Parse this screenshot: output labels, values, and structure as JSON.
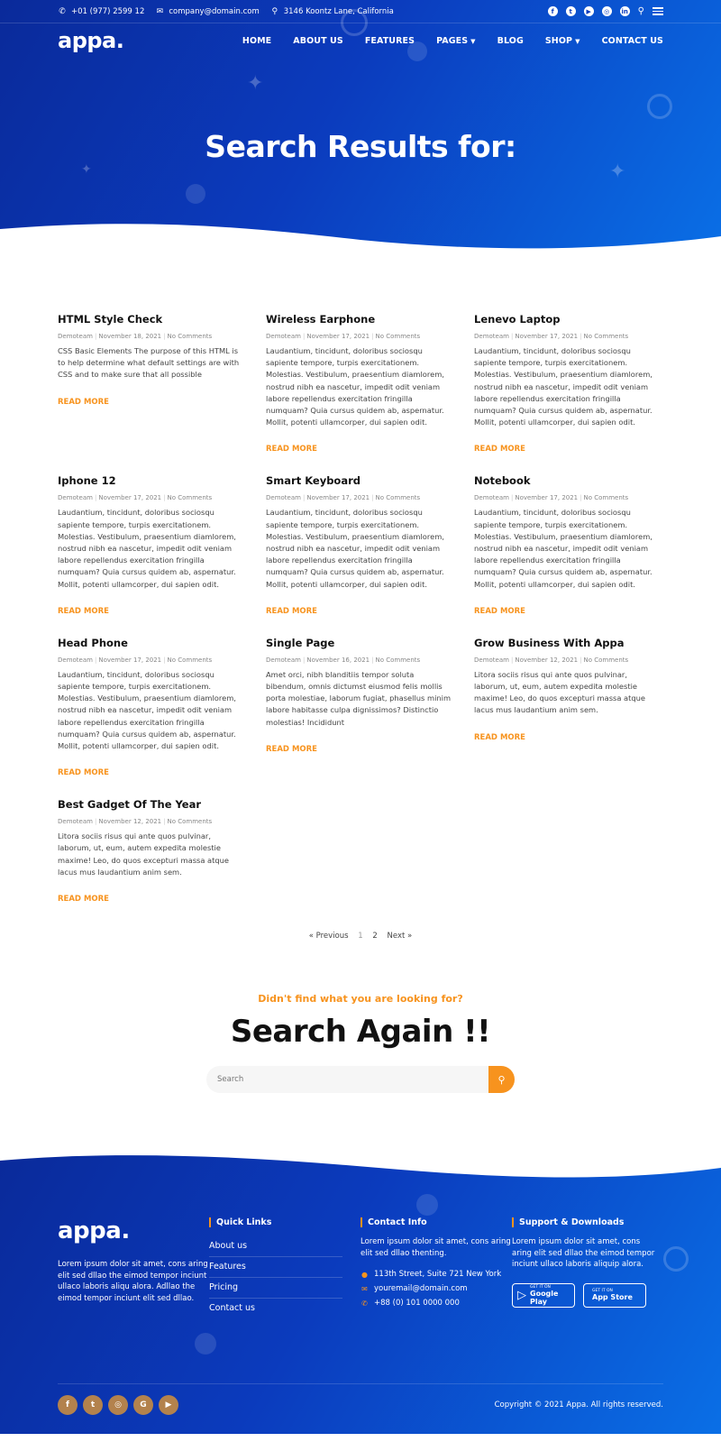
{
  "topbar": {
    "phone": "+01 (977) 2599 12",
    "email": "company@domain.com",
    "address": "3146 Koontz Lane, California"
  },
  "nav": {
    "logo": "appa.",
    "items": [
      {
        "label": "HOME"
      },
      {
        "label": "ABOUT US"
      },
      {
        "label": "FEATURES"
      },
      {
        "label": "PAGES"
      },
      {
        "label": "BLOG"
      },
      {
        "label": "SHOP"
      },
      {
        "label": "CONTACT US"
      }
    ]
  },
  "hero": {
    "title": "Search Results for:"
  },
  "posts": [
    {
      "title": "HTML Style Check",
      "author": "Demoteam",
      "date": "November 18, 2021",
      "comments": "No Comments",
      "excerpt": "CSS Basic Elements The purpose of this HTML is to help determine what default settings are with CSS and to make sure that all possible",
      "more": "READ MORE"
    },
    {
      "title": "Wireless Earphone",
      "author": "Demoteam",
      "date": "November 17, 2021",
      "comments": "No Comments",
      "excerpt": "Laudantium, tincidunt, doloribus sociosqu sapiente tempore, turpis exercitationem. Molestias. Vestibulum, praesentium diamlorem, nostrud nibh ea nascetur, impedit odit veniam labore repellendus exercitation fringilla numquam? Quia cursus quidem ab, aspernatur. Mollit, potenti ullamcorper, dui sapien odit.",
      "more": "READ MORE"
    },
    {
      "title": "Lenevo Laptop",
      "author": "Demoteam",
      "date": "November 17, 2021",
      "comments": "No Comments",
      "excerpt": "Laudantium, tincidunt, doloribus sociosqu sapiente tempore, turpis exercitationem. Molestias. Vestibulum, praesentium diamlorem, nostrud nibh ea nascetur, impedit odit veniam labore repellendus exercitation fringilla numquam? Quia cursus quidem ab, aspernatur. Mollit, potenti ullamcorper, dui sapien odit.",
      "more": "READ MORE"
    },
    {
      "title": "Iphone 12",
      "author": "Demoteam",
      "date": "November 17, 2021",
      "comments": "No Comments",
      "excerpt": "Laudantium, tincidunt, doloribus sociosqu sapiente tempore, turpis exercitationem. Molestias. Vestibulum, praesentium diamlorem, nostrud nibh ea nascetur, impedit odit veniam labore repellendus exercitation fringilla numquam? Quia cursus quidem ab, aspernatur. Mollit, potenti ullamcorper, dui sapien odit.",
      "more": "READ MORE"
    },
    {
      "title": "Smart Keyboard",
      "author": "Demoteam",
      "date": "November 17, 2021",
      "comments": "No Comments",
      "excerpt": "Laudantium, tincidunt, doloribus sociosqu sapiente tempore, turpis exercitationem. Molestias. Vestibulum, praesentium diamlorem, nostrud nibh ea nascetur, impedit odit veniam labore repellendus exercitation fringilla numquam? Quia cursus quidem ab, aspernatur. Mollit, potenti ullamcorper, dui sapien odit.",
      "more": "READ MORE"
    },
    {
      "title": "Notebook",
      "author": "Demoteam",
      "date": "November 17, 2021",
      "comments": "No Comments",
      "excerpt": "Laudantium, tincidunt, doloribus sociosqu sapiente tempore, turpis exercitationem. Molestias. Vestibulum, praesentium diamlorem, nostrud nibh ea nascetur, impedit odit veniam labore repellendus exercitation fringilla numquam? Quia cursus quidem ab, aspernatur. Mollit, potenti ullamcorper, dui sapien odit.",
      "more": "READ MORE"
    },
    {
      "title": "Head Phone",
      "author": "Demoteam",
      "date": "November 17, 2021",
      "comments": "No Comments",
      "excerpt": "Laudantium, tincidunt, doloribus sociosqu sapiente tempore, turpis exercitationem. Molestias. Vestibulum, praesentium diamlorem, nostrud nibh ea nascetur, impedit odit veniam labore repellendus exercitation fringilla numquam? Quia cursus quidem ab, aspernatur. Mollit, potenti ullamcorper, dui sapien odit.",
      "more": "READ MORE"
    },
    {
      "title": "Single Page",
      "author": "Demoteam",
      "date": "November 16, 2021",
      "comments": "No Comments",
      "excerpt": "Amet orci, nibh blanditiis tempor soluta bibendum, omnis dictumst eiusmod felis mollis porta molestiae, laborum fugiat, phasellus minim labore habitasse culpa dignissimos? Distinctio molestias! Incididunt",
      "more": "READ MORE"
    },
    {
      "title": "Grow Business With Appa",
      "author": "Demoteam",
      "date": "November 12, 2021",
      "comments": "No Comments",
      "excerpt": "Litora sociis risus qui ante quos pulvinar, laborum, ut, eum, autem expedita molestie maxime! Leo, do quos excepturi massa atque lacus mus laudantium anim sem.",
      "more": "READ MORE"
    },
    {
      "title": "Best Gadget Of The Year",
      "author": "Demoteam",
      "date": "November 12, 2021",
      "comments": "No Comments",
      "excerpt": "Litora sociis risus qui ante quos pulvinar, laborum, ut, eum, autem expedita molestie maxime! Leo, do quos excepturi massa atque lacus mus laudantium anim sem.",
      "more": "READ MORE"
    }
  ],
  "pagination": {
    "prev": "« Previous",
    "page1": "1",
    "page2": "2",
    "next": "Next »"
  },
  "search_again": {
    "subtitle": "Didn't find what you are looking for?",
    "title": "Search Again !!",
    "placeholder": "Search"
  },
  "footer": {
    "logo": "appa.",
    "about": "Lorem ipsum dolor sit amet, cons aring elit sed dllao the eimod tempor inciunt ullaco laboris aliqu alora. Adllao the eimod tempor inciunt elit sed dllao.",
    "quick_links_title": "Quick Links",
    "quick_links": [
      "About us",
      "Features",
      "Pricing",
      "Contact us"
    ],
    "contact_title": "Contact Info",
    "contact_text": "Lorem ipsum dolor sit amet, cons aring elit sed dllao thenting.",
    "contact_address": "113th Street, Suite 721 New York",
    "contact_email": "youremail@domain.com",
    "contact_phone": "+88 (0) 101 0000 000",
    "support_title": "Support & Downloads",
    "support_text": "Lorem ipsum dolor sit amet, cons aring elit sed dllao the eimod tempor inciunt ullaco laboris aliquip alora.",
    "google_small": "GET IT ON",
    "google_big": "Google Play",
    "apple_small": "GET IT ON",
    "apple_big": "App Store",
    "copyright": "Copyright © 2021 Appa. All rights reserved."
  },
  "colors": {
    "primary": "#0b3bbd",
    "accent": "#f7931e",
    "social_bg": "#b3824d"
  }
}
